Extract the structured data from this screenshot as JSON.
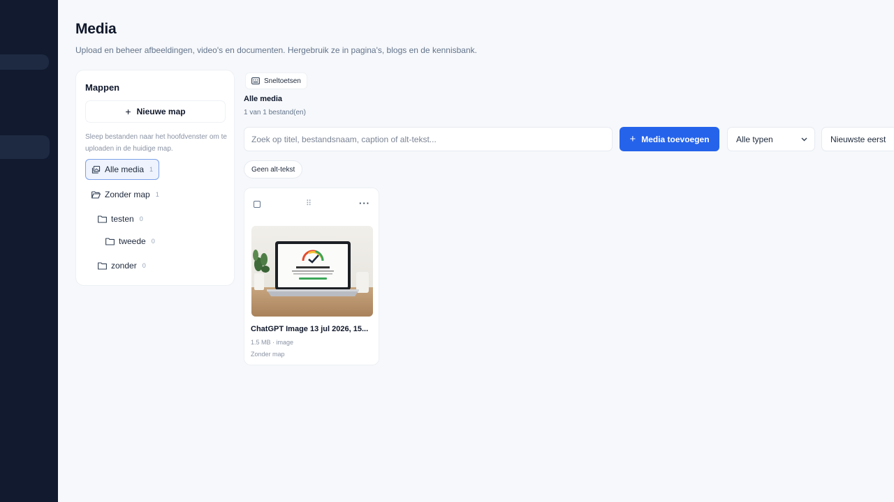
{
  "page": {
    "title": "Media",
    "subtitle": "Upload en beheer afbeeldingen, video's en documenten. Hergebruik ze in pagina's, blogs en de kennisbank."
  },
  "folders": {
    "title": "Mappen",
    "new_folder_label": "Nieuwe map",
    "hint": "Sleep bestanden naar het hoofdvenster om te uploaden in de huidige map.",
    "items": [
      {
        "label": "Alle media",
        "count": "1",
        "icon": "images-icon",
        "active": true
      },
      {
        "label": "Zonder map",
        "count": "1",
        "icon": "folder-open-icon"
      },
      {
        "label": "testen",
        "count": "0",
        "icon": "folder-icon"
      },
      {
        "label": "tweede",
        "count": "0",
        "icon": "folder-icon"
      },
      {
        "label": "zonder",
        "count": "0",
        "icon": "folder-icon"
      }
    ]
  },
  "toolbar": {
    "shortcuts_label": "Sneltoetsen",
    "section_title": "Alle media",
    "count_text": "1 van 1 bestand(en)",
    "search_placeholder": "Zoek op titel, bestandsnaam, caption of alt-tekst...",
    "add_media_label": "Media toevoegen",
    "type_select": "Alle typen",
    "sort_select": "Nieuwste eerst",
    "filter_chip": "Geen alt-tekst",
    "accent_color": "#2563eb"
  },
  "media": [
    {
      "name": "ChatGPT Image 13 jul 2026, 15...",
      "meta": "1.5 MB · image",
      "folder": "Zonder map"
    }
  ]
}
